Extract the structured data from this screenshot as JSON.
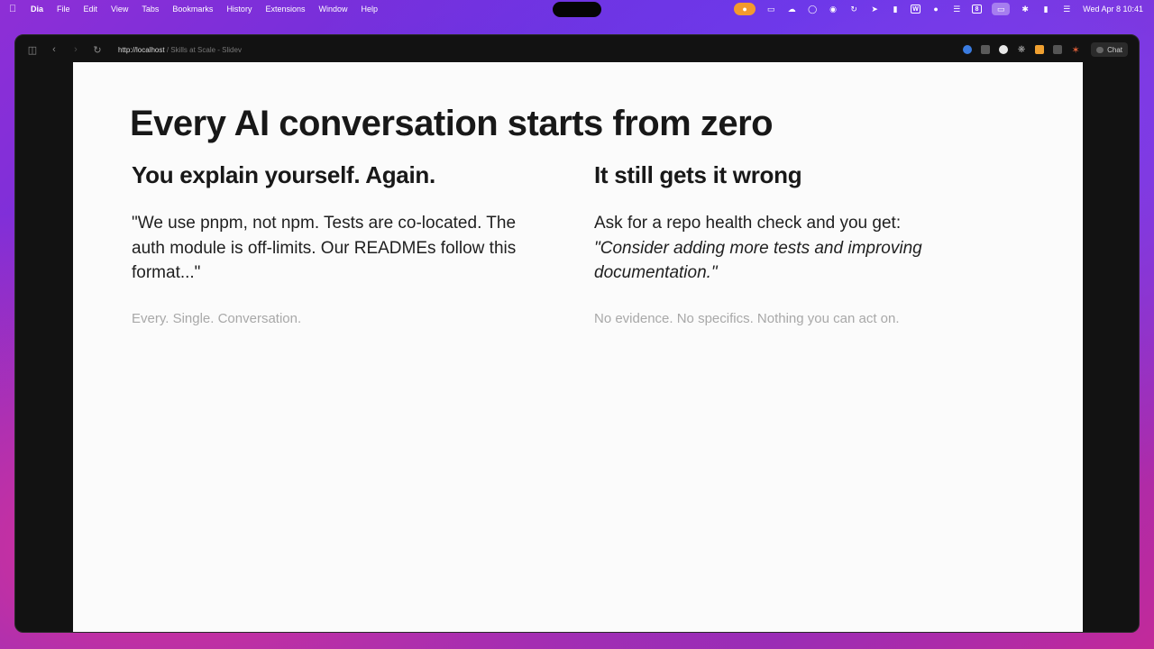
{
  "menubar": {
    "app": "Dia",
    "items": [
      "File",
      "Edit",
      "View",
      "Tabs",
      "Bookmarks",
      "History",
      "Extensions",
      "Window",
      "Help"
    ],
    "clock": "Wed Apr 8  10:41"
  },
  "browser": {
    "url_host": "http://localhost",
    "url_path": " / Skills at Scale - Slidev",
    "chat_label": "Chat"
  },
  "slide": {
    "title": "Every AI conversation starts from zero",
    "left": {
      "heading": "You explain yourself. Again.",
      "body": "\"We use pnpm, not npm. Tests are co-located. The auth module is off-limits. Our READMEs follow this format...\"",
      "note": "Every. Single. Conversation."
    },
    "right": {
      "heading": "It still gets it wrong",
      "body_lead": "Ask for a repo health check and you get:",
      "body_quote": "\"Consider adding more tests and improving documentation.\"",
      "note": "No evidence. No specifics. Nothing you can act on."
    }
  }
}
